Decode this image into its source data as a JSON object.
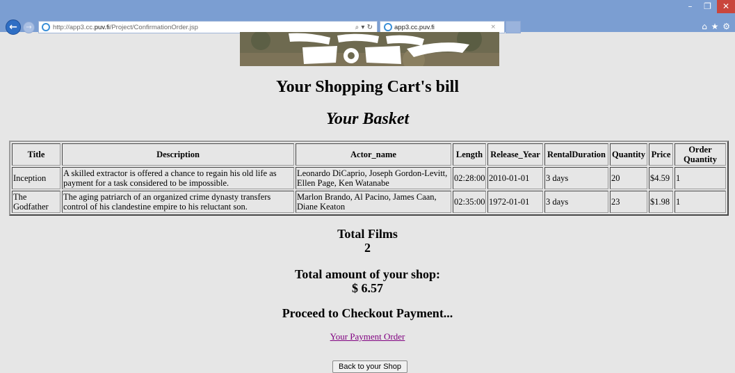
{
  "browser": {
    "url_prefix": "http://app3.cc.",
    "url_domain": "puv.fi",
    "url_path": "/Project/ConfirmationOrder.jsp",
    "search_refresh": "⌕ ▾ ↻",
    "tab_title": "app3.cc.puv.fi",
    "tab_close": "×",
    "back_glyph": "←",
    "forward_glyph": "→",
    "minimize_glyph": "–",
    "maximize_glyph": "❐",
    "close_glyph": "✕",
    "toolbar_glyphs": "⌂ ★ ⚙"
  },
  "page": {
    "title": "Your Shopping Cart's bill",
    "basket_heading": "Your Basket"
  },
  "table": {
    "headers": [
      "Title",
      "Description",
      "Actor_name",
      "Length",
      "Release_Year",
      "RentalDuration",
      "Quantity",
      "Price",
      "Order Quantity"
    ],
    "rows": [
      {
        "title": "Inception",
        "description": "A skilled extractor is offered a chance to regain his old life as payment for a task considered to be impossible.",
        "actor_name": "Leonardo DiCaprio, Joseph Gordon-Levitt, Ellen Page, Ken Watanabe",
        "length": "02:28:00",
        "release_year": "2010-01-01",
        "rental_duration": "3 days",
        "quantity": "20",
        "price": "$4.59",
        "order_quantity": "1"
      },
      {
        "title": "The Godfather",
        "description": "The aging patriarch of an organized crime dynasty transfers control of his clandestine empire to his reluctant son.",
        "actor_name": "Marlon Brando, Al Pacino, James Caan, Diane Keaton",
        "length": "02:35:00",
        "release_year": "1972-01-01",
        "rental_duration": "3 days",
        "quantity": "23",
        "price": "$1.98",
        "order_quantity": "1"
      }
    ]
  },
  "totals": {
    "films_label": "Total Films",
    "films_value": "2",
    "amount_label": "Total amount of your shop:",
    "amount_value": "$ 6.57",
    "proceed_text": "Proceed to Checkout Payment..."
  },
  "links": {
    "payment_order": "Your Payment Order"
  },
  "buttons": {
    "back_to_shop": "Back to your Shop"
  }
}
